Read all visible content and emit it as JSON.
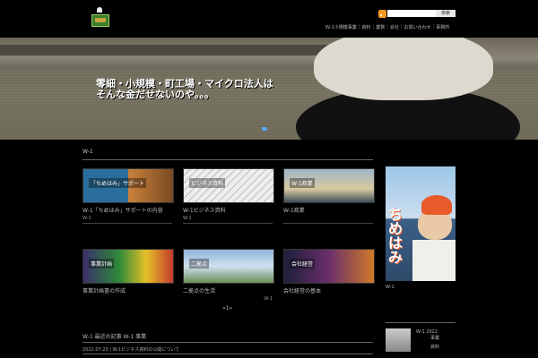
{
  "header": {
    "nav": [
      "W-1小規模事業",
      "資料",
      "業務",
      "会社",
      "お問い合わせ",
      "事務所"
    ],
    "search_button": "検索"
  },
  "hero": {
    "caption_line1": "零細・小規模・町工場・マイクロ法人は",
    "caption_line2": "そんな金だせないのや。。。"
  },
  "section": {
    "title": "W-1"
  },
  "cards": [
    {
      "thumb_text": "「ちめはみ」サポート",
      "title": "W-1「ちめはみ」サポートの内容",
      "meta": "W-1"
    },
    {
      "thumb_text": "ビジネス資料",
      "title": "W-1ビジネス資料",
      "meta": "W-1"
    },
    {
      "thumb_text": "W-1商業",
      "title": "W-1商業",
      "meta": ""
    },
    {
      "thumb_text": "事業計画",
      "title": "事業計画書の作成",
      "meta": ""
    },
    {
      "thumb_text": "二拠点",
      "title": "二拠点の生活",
      "meta": "W-1"
    },
    {
      "thumb_text": "会社経営",
      "title": "会社経営の基本",
      "meta": ""
    }
  ],
  "pager": "«1»",
  "sidebar": {
    "image_text": "ちめはみ",
    "meta": "W-1",
    "recent_title": "W-1 2022",
    "recent_line1": "事業",
    "recent_line2": "資料"
  },
  "bottom": {
    "title": "W-1 最近の記事 W-1 事業",
    "date": "2022.07.20",
    "row_text": "W-1ビジネス資料の公開について"
  },
  "colors": {
    "background": "#000000",
    "rss": "#f39a1e",
    "accent": "#e85a2a"
  }
}
